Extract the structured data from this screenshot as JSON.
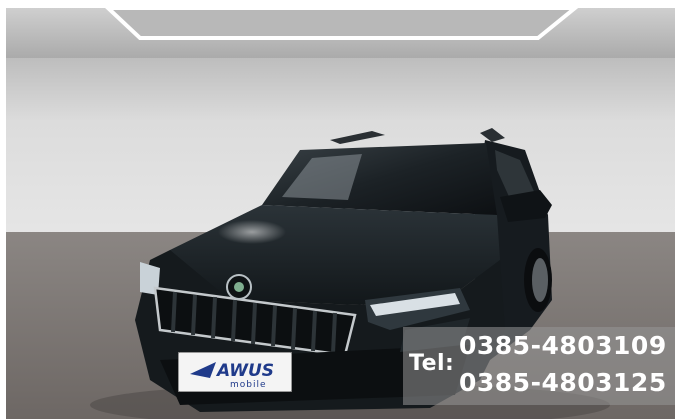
{
  "dealer_plate": {
    "brand": "AWUS",
    "tagline": "mobile"
  },
  "contact_overlay": {
    "label": "Tel:",
    "phone_numbers": [
      "0385-4803109",
      "0385-4803125"
    ]
  },
  "colors": {
    "car_body": "#14191d",
    "showroom_wall": "#d7d7d7",
    "showroom_floor": "#7d7673",
    "plate_accent": "#1f3a8a",
    "overlay_text": "#ffffff"
  }
}
